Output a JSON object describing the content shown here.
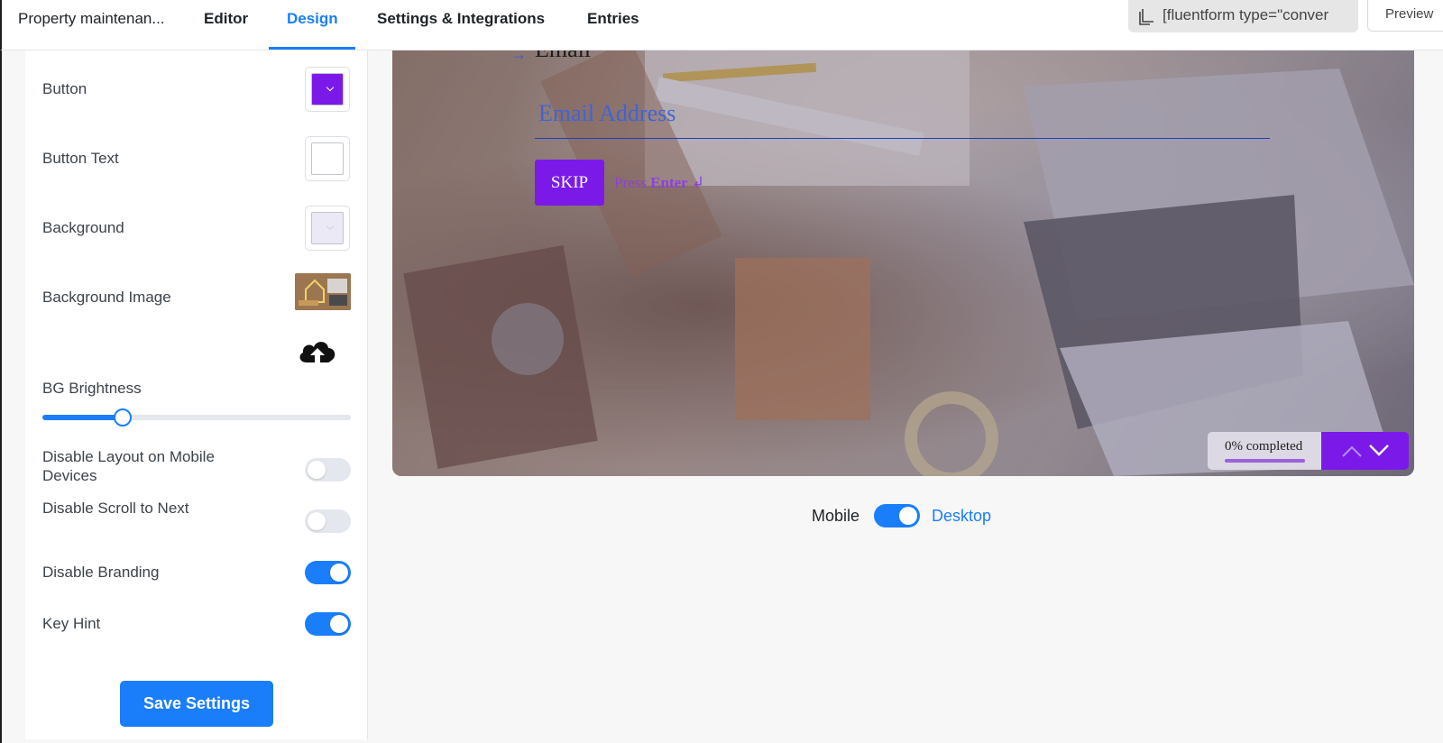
{
  "header": {
    "form_name": "Property maintenan...",
    "tabs": [
      {
        "label": "Editor",
        "active": false
      },
      {
        "label": "Design",
        "active": true
      },
      {
        "label": "Settings & Integrations",
        "active": false
      },
      {
        "label": "Entries",
        "active": false
      }
    ],
    "shortcode": "[fluentform type=\"conver",
    "preview_label": "Preview"
  },
  "settings": {
    "button_label": "Button",
    "button_color": "#7b1ae8",
    "button_text_label": "Button Text",
    "button_text_color": "#ffffff",
    "background_label": "Background",
    "background_color": "#ece9f7",
    "background_image_label": "Background Image",
    "bg_brightness_label": "BG Brightness",
    "bg_brightness_value": 0.26,
    "disable_layout_mobile_label": "Disable Layout on Mobile Devices",
    "disable_layout_mobile_on": false,
    "disable_scroll_label": "Disable Scroll to Next",
    "disable_scroll_on": false,
    "disable_branding_label": "Disable Branding",
    "disable_branding_on": true,
    "key_hint_label": "Key Hint",
    "key_hint_on": true,
    "save_label": "Save Settings"
  },
  "preview": {
    "question_label": "Email",
    "email_placeholder": "Email Address",
    "skip_label": "SKIP",
    "press_text": "Press",
    "enter_text": "Enter",
    "enter_symbol": "↲",
    "progress_text": "0% completed",
    "accent_color": "#7b1ae8"
  },
  "device_switch": {
    "mobile_label": "Mobile",
    "desktop_label": "Desktop",
    "desktop_selected": true
  },
  "icons": [
    "copy-icon",
    "chevron-down-icon",
    "cloud-upload-icon",
    "arrow-right-icon",
    "chevron-up-icon",
    "chevron-down-icon"
  ]
}
